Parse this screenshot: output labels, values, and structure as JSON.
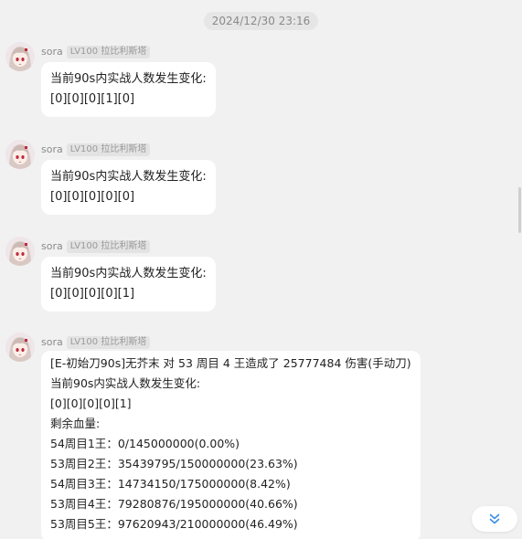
{
  "timestamp": "2024/12/30 23:16",
  "colors": {
    "background": "#f1f1f1",
    "bubble": "#ffffff",
    "accent": "#3a8ee6"
  },
  "messages": [
    {
      "sender": "sora",
      "title": "LV100 拉比利斯塔",
      "lines": [
        "当前90s内实战人数发生变化:",
        "[0][0][0][1][0]"
      ]
    },
    {
      "sender": "sora",
      "title": "LV100 拉比利斯塔",
      "lines": [
        "当前90s内实战人数发生变化:",
        "[0][0][0][0][0]"
      ]
    },
    {
      "sender": "sora",
      "title": "LV100 拉比利斯塔",
      "lines": [
        "当前90s内实战人数发生变化:",
        "[0][0][0][0][1]"
      ]
    },
    {
      "sender": "sora",
      "title": "LV100 拉比利斯塔",
      "lines": [
        "[E-初始刀90s]无芥末 对 53 周目 4 王造成了 25777484 伤害(手动刀)",
        "当前90s内实战人数发生变化:",
        "[0][0][0][0][1]",
        "剩余血量:",
        "54周目1王：0/145000000(0.00%)",
        "53周目2王：35439795/150000000(23.63%)",
        "54周目3王：14734150/175000000(8.42%)",
        "53周目4王：79280876/195000000(40.66%)",
        "53周目5王：97620943/210000000(46.49%)"
      ]
    }
  ],
  "scroll_button_icon": "double-chevron-down-icon"
}
